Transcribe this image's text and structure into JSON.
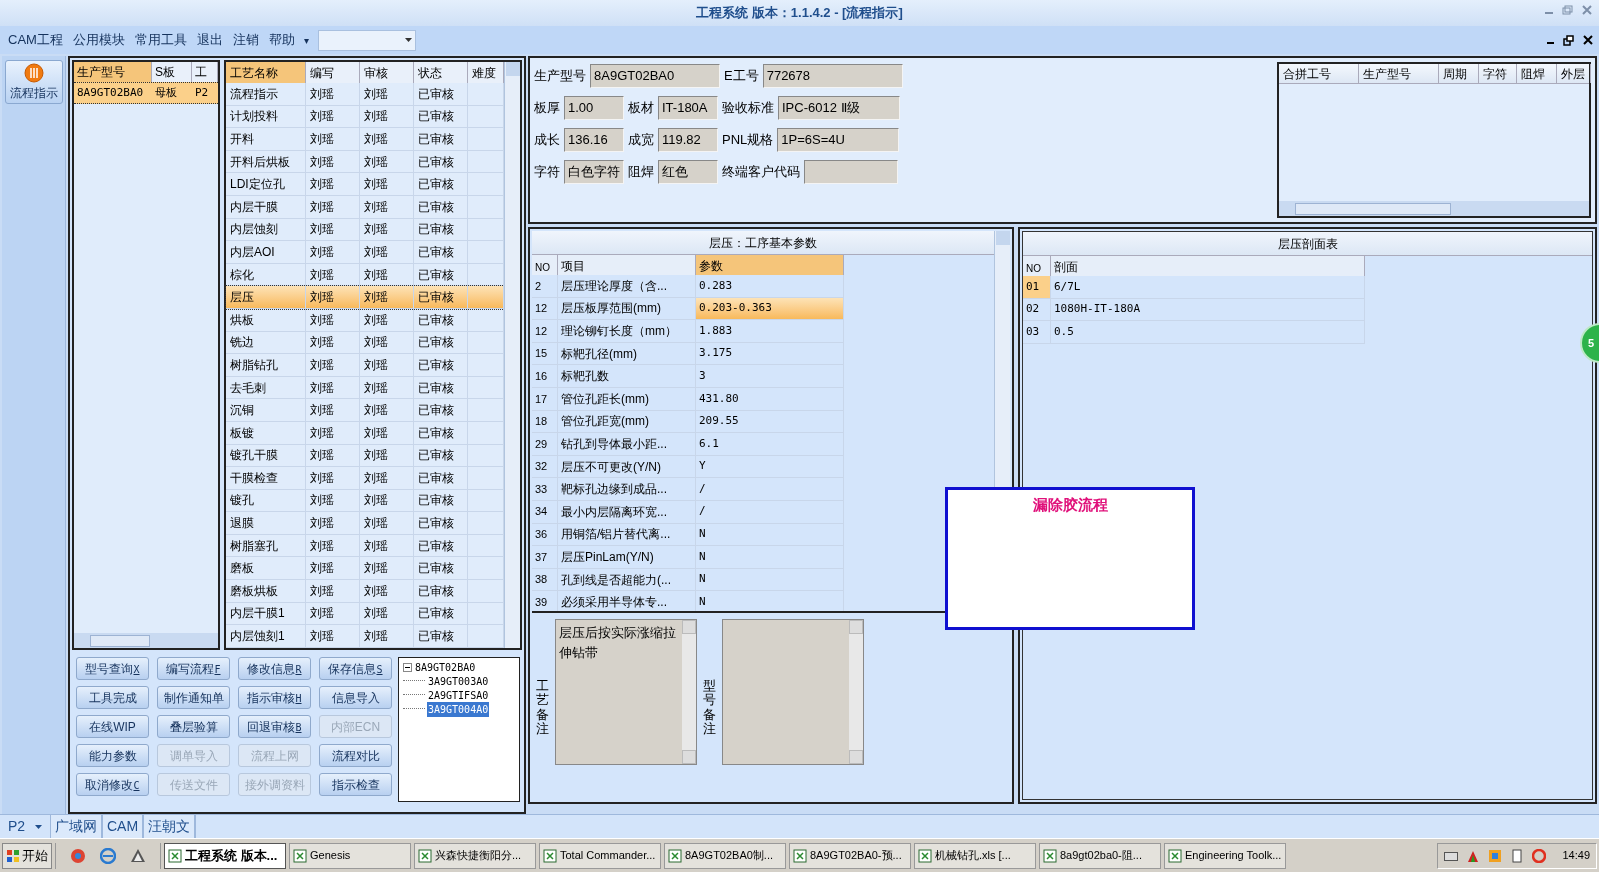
{
  "window": {
    "title": "工程系统  版本：1.1.4.2 - [流程指示]"
  },
  "menu": [
    "CAM工程",
    "公用模块",
    "常用工具",
    "退出",
    "注销",
    "帮助"
  ],
  "menu_more": "▾",
  "nav": {
    "label": "流程指示",
    "selected": true
  },
  "product_table": {
    "columns": [
      "生产型号",
      "S板",
      "工"
    ],
    "rows": [
      {
        "cells": [
          "8A9GT02BA0",
          "母板",
          "P2"
        ],
        "selected": true
      }
    ]
  },
  "process_table": {
    "columns": [
      "工艺名称",
      "编写",
      "审核",
      "状态",
      "难度"
    ],
    "rows": [
      {
        "cells": [
          "流程指示",
          "刘瑶",
          "刘瑶",
          "已审核"
        ],
        "selected": false
      },
      {
        "cells": [
          "计划投料",
          "刘瑶",
          "刘瑶",
          "已审核"
        ],
        "selected": false
      },
      {
        "cells": [
          "开料",
          "刘瑶",
          "刘瑶",
          "已审核"
        ],
        "selected": false
      },
      {
        "cells": [
          "开料后烘板",
          "刘瑶",
          "刘瑶",
          "已审核"
        ],
        "selected": false
      },
      {
        "cells": [
          "LDI定位孔",
          "刘瑶",
          "刘瑶",
          "已审核"
        ],
        "selected": false
      },
      {
        "cells": [
          "内层干膜",
          "刘瑶",
          "刘瑶",
          "已审核"
        ],
        "selected": false
      },
      {
        "cells": [
          "内层蚀刻",
          "刘瑶",
          "刘瑶",
          "已审核"
        ],
        "selected": false
      },
      {
        "cells": [
          "内层AOI",
          "刘瑶",
          "刘瑶",
          "已审核"
        ],
        "selected": false
      },
      {
        "cells": [
          "棕化",
          "刘瑶",
          "刘瑶",
          "已审核"
        ],
        "selected": false
      },
      {
        "cells": [
          "层压",
          "刘瑶",
          "刘瑶",
          "已审核"
        ],
        "selected": true
      },
      {
        "cells": [
          "烘板",
          "刘瑶",
          "刘瑶",
          "已审核"
        ],
        "selected": false
      },
      {
        "cells": [
          "铣边",
          "刘瑶",
          "刘瑶",
          "已审核"
        ],
        "selected": false
      },
      {
        "cells": [
          "树脂钻孔",
          "刘瑶",
          "刘瑶",
          "已审核"
        ],
        "selected": false
      },
      {
        "cells": [
          "去毛刺",
          "刘瑶",
          "刘瑶",
          "已审核"
        ],
        "selected": false
      },
      {
        "cells": [
          "沉铜",
          "刘瑶",
          "刘瑶",
          "已审核"
        ],
        "selected": false
      },
      {
        "cells": [
          "板镀",
          "刘瑶",
          "刘瑶",
          "已审核"
        ],
        "selected": false
      },
      {
        "cells": [
          "镀孔干膜",
          "刘瑶",
          "刘瑶",
          "已审核"
        ],
        "selected": false
      },
      {
        "cells": [
          "干膜检查",
          "刘瑶",
          "刘瑶",
          "已审核"
        ],
        "selected": false
      },
      {
        "cells": [
          "镀孔",
          "刘瑶",
          "刘瑶",
          "已审核"
        ],
        "selected": false
      },
      {
        "cells": [
          "退膜",
          "刘瑶",
          "刘瑶",
          "已审核"
        ],
        "selected": false
      },
      {
        "cells": [
          "树脂塞孔",
          "刘瑶",
          "刘瑶",
          "已审核"
        ],
        "selected": false
      },
      {
        "cells": [
          "磨板",
          "刘瑶",
          "刘瑶",
          "已审核"
        ],
        "selected": false
      },
      {
        "cells": [
          "磨板烘板",
          "刘瑶",
          "刘瑶",
          "已审核"
        ],
        "selected": false
      },
      {
        "cells": [
          "内层干膜1",
          "刘瑶",
          "刘瑶",
          "已审核"
        ],
        "selected": false
      },
      {
        "cells": [
          "内层蚀刻1",
          "刘瑶",
          "刘瑶",
          "已审核"
        ],
        "selected": false
      }
    ]
  },
  "buttons": [
    {
      "label": "型号查询",
      "shortcut": "X",
      "disabled": false
    },
    {
      "label": "编写流程",
      "shortcut": "F",
      "disabled": false
    },
    {
      "label": "修改信息",
      "shortcut": "R",
      "disabled": false
    },
    {
      "label": "保存信息",
      "shortcut": "S",
      "disabled": false
    },
    {
      "label": "工具完成",
      "disabled": false
    },
    {
      "label": "制作通知单",
      "disabled": false
    },
    {
      "label": "指示审核",
      "shortcut": "H",
      "disabled": false
    },
    {
      "label": "信息导入",
      "disabled": false
    },
    {
      "label": "在线WIP",
      "disabled": false
    },
    {
      "label": "叠层验算",
      "disabled": false
    },
    {
      "label": "回退审核",
      "shortcut": "B",
      "disabled": false
    },
    {
      "label": "内部ECN",
      "disabled": true
    },
    {
      "label": "能力参数",
      "disabled": false
    },
    {
      "label": "调单导入",
      "disabled": true
    },
    {
      "label": "流程上网",
      "disabled": true
    },
    {
      "label": "流程对比",
      "disabled": false
    },
    {
      "label": "取消修改",
      "shortcut": "C",
      "disabled": false
    },
    {
      "label": "传送文件",
      "disabled": true
    },
    {
      "label": "接外调资料",
      "disabled": true
    },
    {
      "label": "指示检查",
      "disabled": false
    }
  ],
  "tree": [
    {
      "label": "8A9GT02BA0",
      "expanded": true,
      "selected": false,
      "children": [
        {
          "label": "3A9GT003A0",
          "selected": false
        },
        {
          "label": "2A9GTIFSA0",
          "selected": false
        },
        {
          "label": "3A9GT004A0",
          "selected": true
        }
      ]
    }
  ],
  "info_fields": [
    [
      {
        "label": "生产型号",
        "value": "8A9GT02BA0"
      },
      {
        "label": "E工号",
        "value": "772678"
      }
    ],
    [
      {
        "label": "板厚",
        "value": "1.00"
      },
      {
        "label": "板材",
        "value": "IT-180A"
      },
      {
        "label": "验收标准",
        "value": "IPC-6012 Ⅱ级"
      }
    ],
    [
      {
        "label": "成长",
        "value": "136.16"
      },
      {
        "label": "成宽",
        "value": "119.82"
      },
      {
        "label": "PNL规格",
        "value": "1P=6S=4U"
      }
    ],
    [
      {
        "label": "字符",
        "value": "白色字符"
      },
      {
        "label": "阻焊",
        "value": "红色"
      },
      {
        "label": "终端客户代码"
      }
    ]
  ],
  "merge_table": {
    "columns": [
      "合拼工号",
      "生产型号",
      "周期",
      "字符",
      "阻焊",
      "外层"
    ]
  },
  "params": {
    "title": "层压：工序基本参数",
    "columns": [
      "NO",
      "项目",
      "参数"
    ],
    "rows": [
      {
        "cells": [
          "2",
          "层压理论厚度（含...",
          "0.283"
        ],
        "selected": false
      },
      {
        "cells": [
          "12",
          "层压板厚范围(mm)",
          "0.203-0.363"
        ],
        "selected": true
      },
      {
        "cells": [
          "12",
          "理论铆钉长度（mm）",
          "1.883"
        ],
        "selected": false
      },
      {
        "cells": [
          "15",
          "标靶孔径(mm)",
          "3.175"
        ],
        "selected": false
      },
      {
        "cells": [
          "16",
          "标靶孔数",
          "3"
        ],
        "selected": false
      },
      {
        "cells": [
          "17",
          "管位孔距长(mm)",
          "431.80"
        ],
        "selected": false
      },
      {
        "cells": [
          "18",
          "管位孔距宽(mm)",
          "209.55"
        ],
        "selected": false
      },
      {
        "cells": [
          "29",
          "钻孔到导体最小距...",
          "6.1"
        ],
        "selected": false
      },
      {
        "cells": [
          "32",
          "层压不可更改(Y/N)",
          "Y"
        ],
        "selected": false
      },
      {
        "cells": [
          "33",
          "靶标孔边缘到成品...",
          "/"
        ],
        "selected": false
      },
      {
        "cells": [
          "34",
          "最小内层隔离环宽...",
          "/"
        ],
        "selected": false
      },
      {
        "cells": [
          "36",
          "用铜箔/铝片替代离...",
          "N"
        ],
        "selected": false
      },
      {
        "cells": [
          "37",
          "层压PinLam(Y/N)",
          "N"
        ],
        "selected": false
      },
      {
        "cells": [
          "38",
          "孔到线是否超能力(...",
          "N"
        ],
        "selected": false
      },
      {
        "cells": [
          "39",
          "必须采用半导体专...",
          "N"
        ],
        "selected": false
      }
    ]
  },
  "remarks": [
    {
      "label": "工艺备注",
      "value": "层压后按实际涨缩拉伸钻带"
    },
    {
      "label": "型号备注"
    }
  ],
  "profile": {
    "title": "层压剖面表",
    "columns": [
      "NO",
      "剖面"
    ],
    "rows": [
      {
        "cells": [
          "01",
          "6/7L"
        ],
        "selected": true
      },
      {
        "cells": [
          "02",
          "1080H-IT-180A"
        ],
        "selected": false
      },
      {
        "cells": [
          "03",
          "0.5"
        ],
        "selected": false
      }
    ]
  },
  "popup": {
    "title": "漏除胶流程"
  },
  "side_badge": "5",
  "status_bar": {
    "factory": "P2",
    "items": [
      "广域网",
      "CAM",
      "汪朝文"
    ]
  },
  "taskbar": {
    "start": "开始",
    "tasks": [
      {
        "label": "工程系统  版本...",
        "selected": true
      },
      {
        "label": "Genesis",
        "selected": false
      },
      {
        "label": "兴森快捷衡阳分...",
        "selected": false
      },
      {
        "label": "Total Commander...",
        "selected": false
      },
      {
        "label": "8A9GT02BA0制...",
        "selected": false
      },
      {
        "label": "8A9GT02BA0-预...",
        "selected": false
      },
      {
        "label": "机械钻孔.xls  [...",
        "selected": false
      },
      {
        "label": "8a9gt02ba0-阻...",
        "selected": false
      },
      {
        "label": "Engineering Toolk...",
        "selected": false
      }
    ],
    "time": "14:49"
  }
}
